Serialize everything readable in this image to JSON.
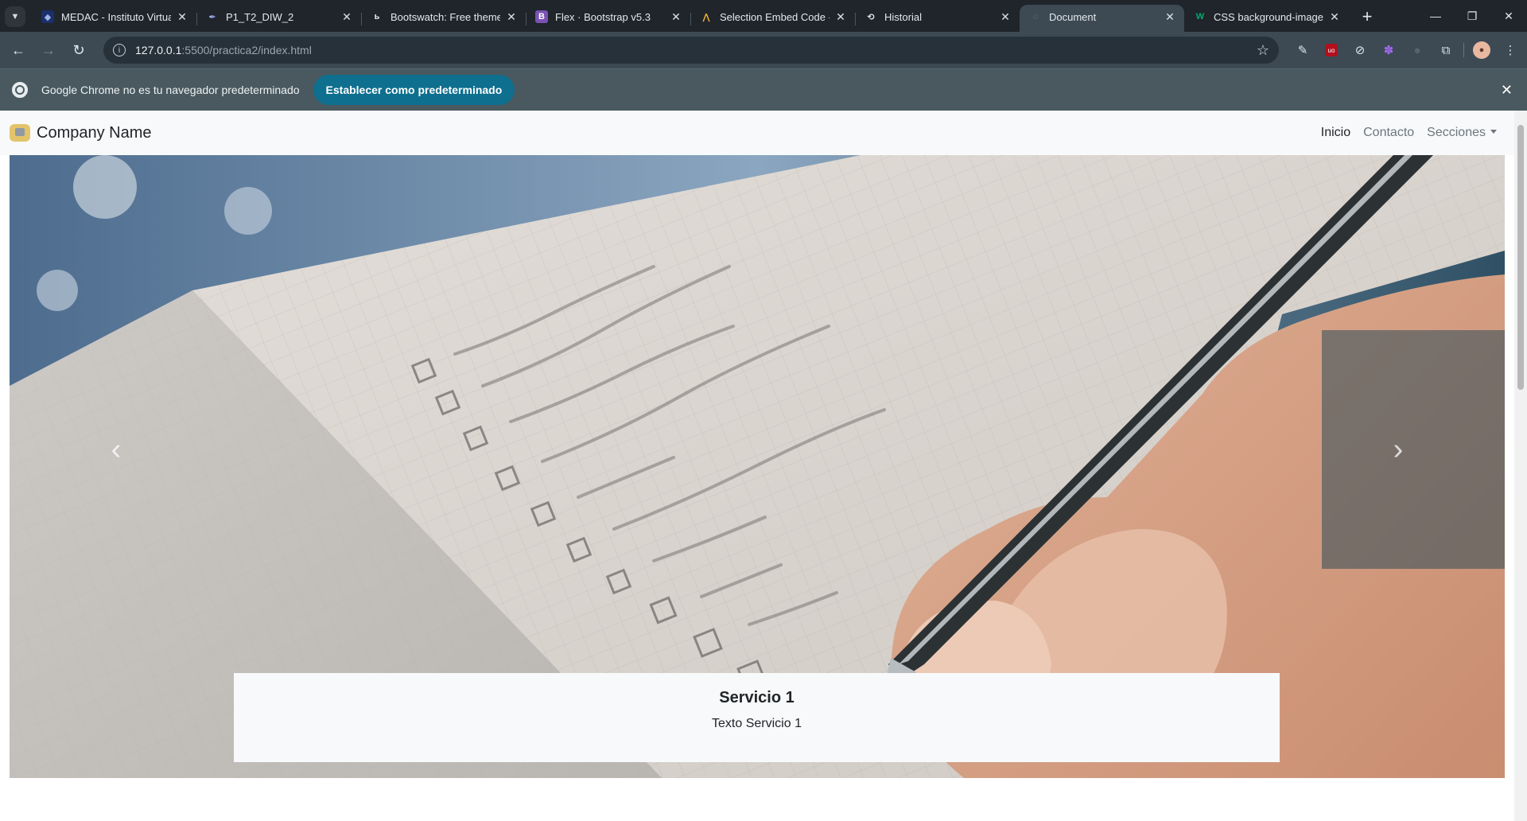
{
  "browser": {
    "tabs": [
      {
        "title": "MEDAC - Instituto Virtual",
        "icon": "shield-icon",
        "active": false
      },
      {
        "title": "P1_T2_DIW_2",
        "icon": "ink-pen-icon",
        "active": false
      },
      {
        "title": "Bootswatch: Free themes",
        "icon": "bootswatch-icon",
        "active": false
      },
      {
        "title": "Flex · Bootstrap v5.3",
        "icon": "bootstrap-icon",
        "active": false
      },
      {
        "title": "Selection Embed Code - C",
        "icon": "embed-icon",
        "active": false
      },
      {
        "title": "Historial",
        "icon": "history-icon",
        "active": false
      },
      {
        "title": "Document",
        "icon": "globe-icon",
        "active": true
      },
      {
        "title": "CSS background-image p",
        "icon": "w3schools-icon",
        "active": false
      }
    ],
    "url": {
      "host": "127.0.0.1",
      "path": ":5500/practica2/index.html"
    },
    "infobar": {
      "message": "Google Chrome no es tu navegador predeterminado",
      "button": "Establecer como predeterminado"
    }
  },
  "page": {
    "brand": "Company Name",
    "nav": [
      {
        "label": "Inicio",
        "active": true
      },
      {
        "label": "Contacto",
        "active": false
      },
      {
        "label": "Secciones",
        "active": false,
        "dropdown": true
      }
    ],
    "carousel": {
      "caption_title": "Servicio 1",
      "caption_text": "Texto Servicio 1"
    }
  },
  "colors": {
    "tabstrip": "#1f252a",
    "toolbar": "#3d4a54",
    "infobar": "#49595f",
    "infobar_button": "#0e6f8e",
    "navbar": "#f8f9fa"
  }
}
